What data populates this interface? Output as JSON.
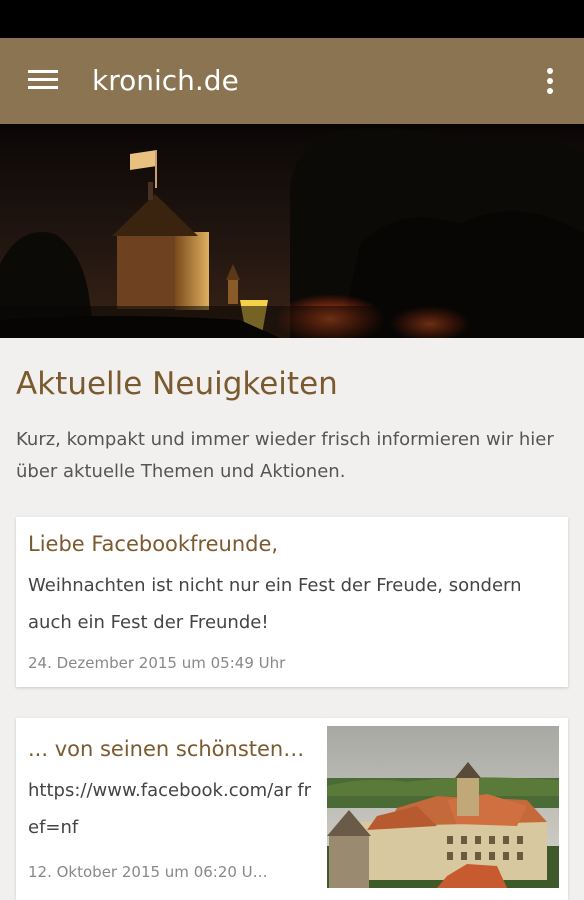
{
  "app_bar": {
    "title": "kronich.de",
    "menu_icon": "hamburger-menu-icon",
    "overflow_icon": "more-vertical-icon",
    "color": "#8a7452"
  },
  "section": {
    "title": "Aktuelle Neuigkeiten",
    "intro": "Kurz, kompakt und immer wieder frisch informieren wir hier über aktuelle Themen und Aktionen."
  },
  "posts": [
    {
      "title": "Liebe Facebookfreunde,",
      "text": "Weihnachten ist nicht nur ein Fest der Freude, sondern auch ein Fest der Freunde!",
      "date": "24. Dezember 2015 um 05:49 Uhr"
    },
    {
      "title": "... von seinen schönsten…",
      "text": "https://www.facebook.com/ar fref=nf",
      "date": "12. Oktober 2015 um 06:20 U…"
    }
  ],
  "colors": {
    "accent": "#7a5a2e",
    "background": "#f2f0ee"
  }
}
